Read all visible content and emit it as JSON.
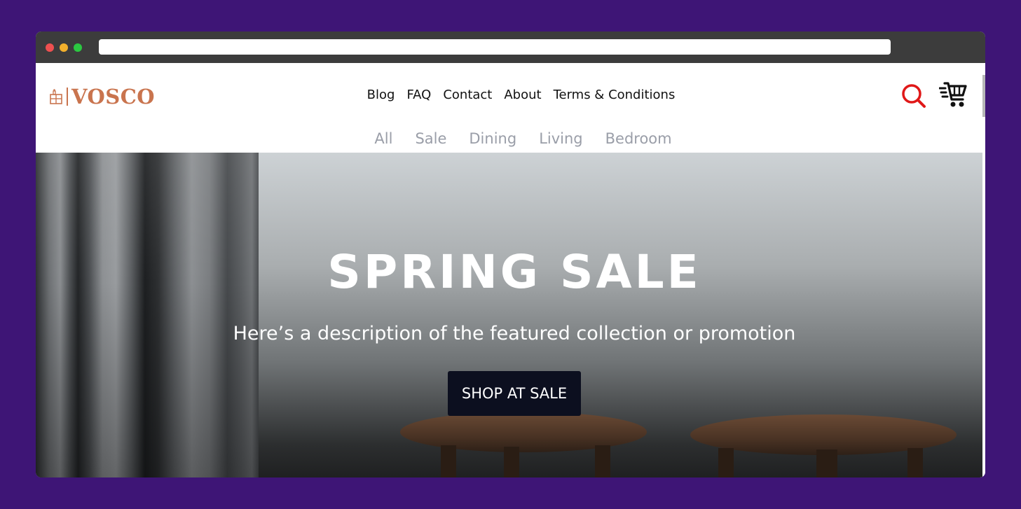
{
  "browser": {
    "address": ""
  },
  "brand": {
    "name": "VOSCO",
    "color": "#c9744e"
  },
  "main_nav": [
    {
      "label": "Blog"
    },
    {
      "label": "FAQ"
    },
    {
      "label": "Contact"
    },
    {
      "label": "About"
    },
    {
      "label": "Terms & Conditions"
    }
  ],
  "category_nav": [
    {
      "label": "All"
    },
    {
      "label": "Sale"
    },
    {
      "label": "Dining"
    },
    {
      "label": "Living"
    },
    {
      "label": "Bedroom"
    }
  ],
  "header_icons": {
    "search": "search-icon",
    "search_color": "#e01818",
    "cart": "cart-icon"
  },
  "hero": {
    "title": "SPRING SALE",
    "description": "Here’s a description of the featured collection or promotion",
    "button_label": "SHOP AT SALE",
    "button_color": "#0c0f1f"
  }
}
